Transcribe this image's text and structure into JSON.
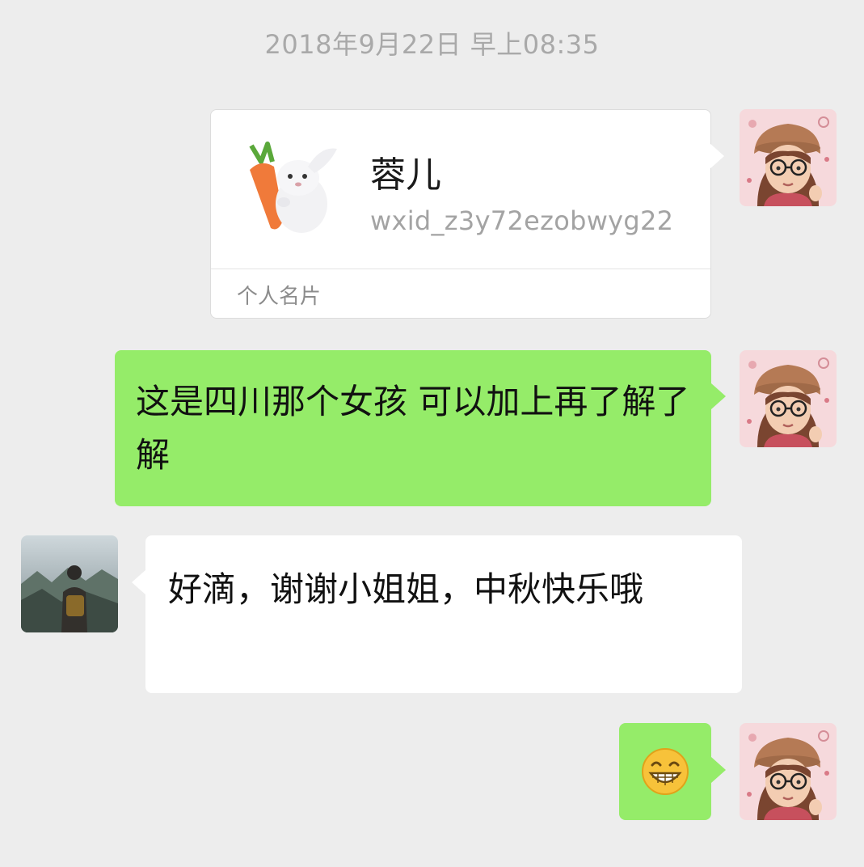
{
  "chat": {
    "timestamp": "2018年9月22日 早上08:35",
    "contact_card": {
      "name": "蓉儿",
      "wxid": "wxid_z3y72ezobwyg22",
      "footer_label": "个人名片",
      "thumbnail_icon": "rabbit-with-carrot-icon"
    },
    "messages": [
      {
        "sender": "me",
        "type": "text",
        "text": "这是四川那个女孩 可以加上再了解了解"
      },
      {
        "sender": "other",
        "type": "text",
        "text": "好滴，谢谢小姐姐，中秋快乐哦"
      },
      {
        "sender": "me",
        "type": "emoji",
        "emoji_icon": "grinning-face-emoji"
      }
    ]
  },
  "colors": {
    "background": "#ededed",
    "sent_bubble": "#95ec69",
    "received_bubble": "#ffffff",
    "timestamp_text": "#a9a9a9"
  }
}
